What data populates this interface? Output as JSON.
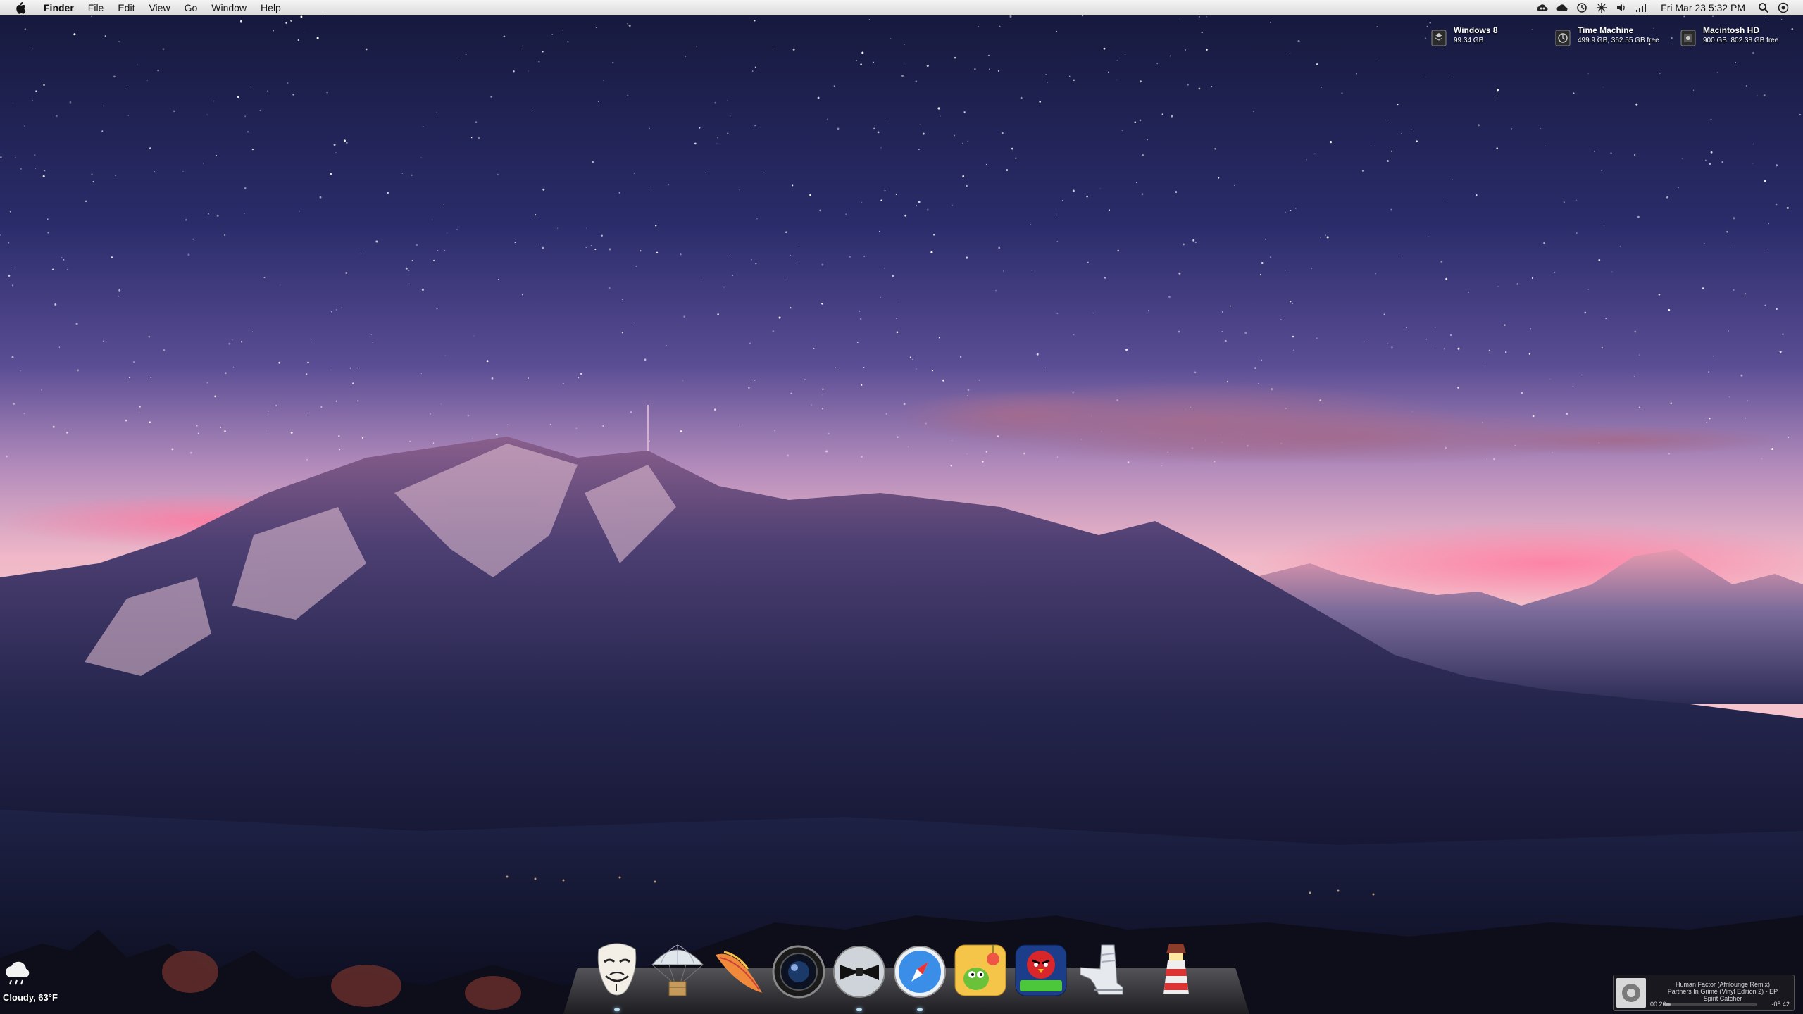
{
  "menubar": {
    "apple_icon": "apple-logo-icon",
    "app_name": "Finder",
    "menus": [
      "File",
      "Edit",
      "View",
      "Go",
      "Window",
      "Help"
    ],
    "status_icons": [
      "creative-cloud-icon",
      "cloud-icon",
      "time-machine-icon",
      "network-icon",
      "volume-icon",
      "signal-icon"
    ],
    "clock": "Fri Mar 23  5:32 PM",
    "right_icons": [
      "spotlight-icon",
      "notification-icon"
    ]
  },
  "drives": [
    {
      "name": "Windows 8",
      "info": "99.34 GB"
    },
    {
      "name": "Time Machine",
      "info": "499.9 GB, 362.55 GB free"
    },
    {
      "name": "Macintosh HD",
      "info": "900 GB, 802.38 GB free"
    }
  ],
  "weather": {
    "text": "Cloudy, 63°F",
    "icon": "cloud-rain-icon"
  },
  "dock": {
    "items": [
      {
        "name": "guy-fawkes-mask-icon",
        "running": true
      },
      {
        "name": "parachute-delivery-icon",
        "running": false
      },
      {
        "name": "feather-quill-icon",
        "running": false
      },
      {
        "name": "camera-lens-icon",
        "running": false
      },
      {
        "name": "bowtie-disc-icon",
        "running": true
      },
      {
        "name": "safari-compass-icon",
        "running": true
      },
      {
        "name": "cut-the-rope-icon",
        "running": false
      },
      {
        "name": "angry-birds-space-icon",
        "running": false
      },
      {
        "name": "sneaker-icon",
        "running": false
      },
      {
        "name": "lighthouse-icon",
        "running": false
      }
    ]
  },
  "music": {
    "line1": "Human Factor (Afrilounge Remix)",
    "line2": "Partners In Grime (Vinyl Edition 2) - EP",
    "line3": "Spirit Catcher",
    "elapsed": "00:26",
    "remaining": "-05:42",
    "progress_fraction": 0.07
  },
  "colors": {
    "sky_top": "#1a1d3f",
    "sky_mid": "#5c4a8a",
    "sky_horizon": "#e8a6b8",
    "mountain": "#2c2c58"
  }
}
